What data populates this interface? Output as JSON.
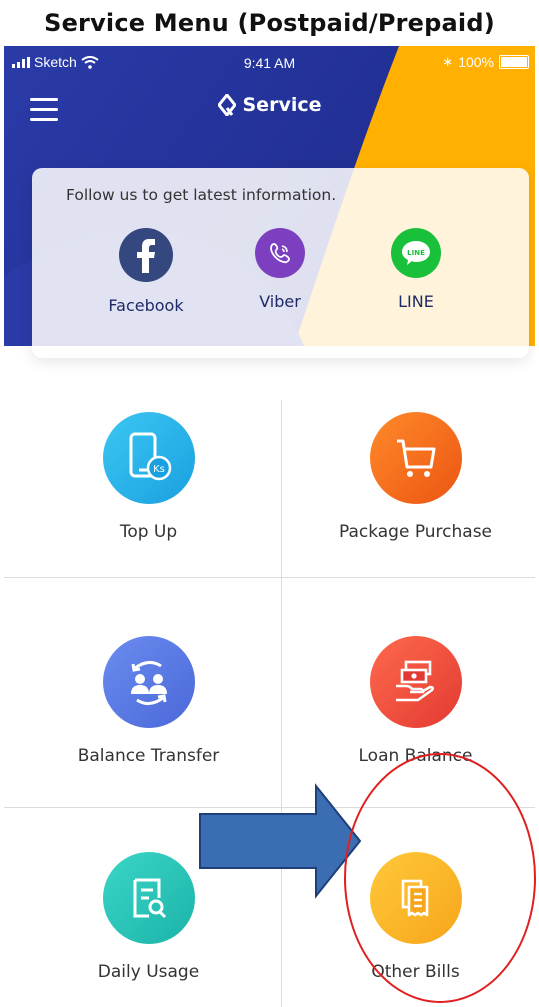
{
  "caption": "Service Menu (Postpaid/Prepaid)",
  "status_bar": {
    "carrier": "Sketch",
    "time": "9:41 AM",
    "battery": "100%"
  },
  "header": {
    "title": "Service"
  },
  "social": {
    "heading": "Follow us to get latest information.",
    "items": [
      {
        "label": "Facebook",
        "color": "#3b5998",
        "icon": "facebook-icon"
      },
      {
        "label": "Viber",
        "color": "#7b3fbf",
        "icon": "viber-icon"
      },
      {
        "label": "LINE",
        "color": "#19c13a",
        "icon": "line-icon",
        "badge": "LINE"
      }
    ]
  },
  "services": [
    {
      "label": "Top Up",
      "icon": "phone-topup-icon",
      "color": "#2bb4ea",
      "badge": "Ks"
    },
    {
      "label": "Package Purchase",
      "icon": "cart-icon",
      "color": "#f26a1f"
    },
    {
      "label": "Balance Transfer",
      "icon": "users-exchange-icon",
      "color": "#5b7de6"
    },
    {
      "label": "Loan Balance",
      "icon": "loan-hand-icon",
      "color": "#f04a3c"
    },
    {
      "label": "Daily Usage",
      "icon": "usage-report-icon",
      "color": "#26c4b8"
    },
    {
      "label": "Other Bills",
      "icon": "bills-icon",
      "color": "#fbb314"
    }
  ],
  "colors": {
    "brand_blue": "#2334a0",
    "brand_orange": "#ffb000",
    "annotation_red": "#e02020",
    "annotation_arrow": "#3b6db3"
  }
}
